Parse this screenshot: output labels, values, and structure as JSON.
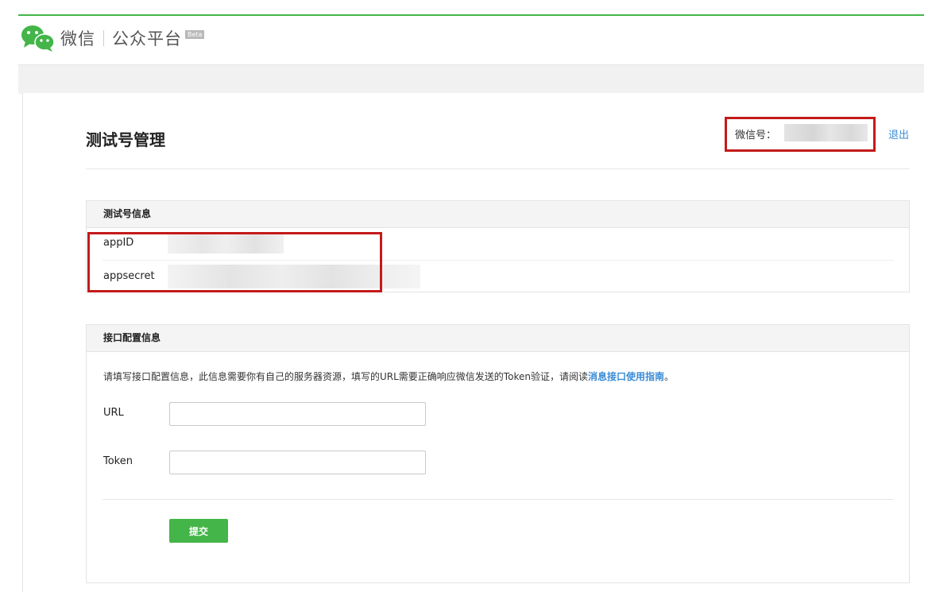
{
  "header": {
    "brand": "微信",
    "platform": "公众平台",
    "badge": "Beta",
    "accent_color": "#44b549",
    "logo_icon": "wechat-logo-icon"
  },
  "page": {
    "title": "测试号管理",
    "wechat_id_label": "微信号：",
    "logout": "退出"
  },
  "test_account_panel": {
    "title": "测试号信息",
    "rows": [
      {
        "label": "appID"
      },
      {
        "label": "appsecret"
      }
    ]
  },
  "interface_panel": {
    "title": "接口配置信息",
    "description": "请填写接口配置信息，此信息需要你有自己的服务器资源，填写的URL需要正确响应微信发送的Token验证，请阅读",
    "description_link": "消息接口使用指南",
    "description_end": "。",
    "fields": [
      {
        "label": "URL",
        "value": ""
      },
      {
        "label": "Token",
        "value": ""
      }
    ],
    "submit": "提交"
  },
  "colors": {
    "link": "#3a8cd6",
    "highlight_box": "#c41a1a",
    "button": "#44b549"
  }
}
